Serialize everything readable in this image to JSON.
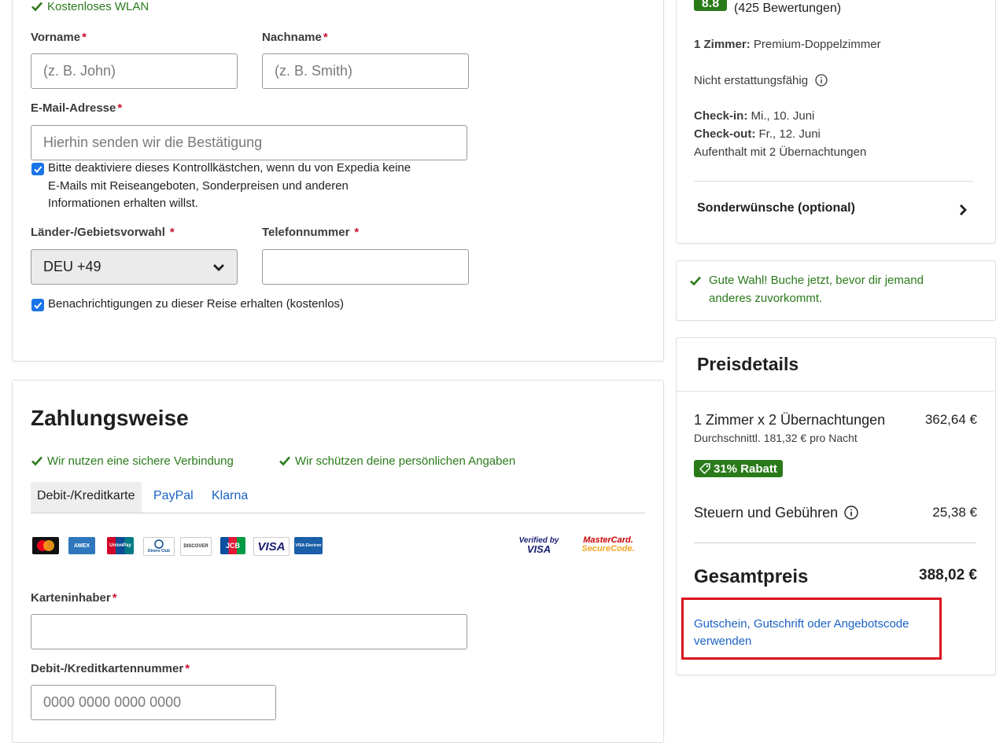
{
  "amenity": {
    "wifi": "Kostenloses WLAN"
  },
  "form": {
    "first_name_label": "Vorname",
    "first_name_placeholder": "(z. B. John)",
    "last_name_label": "Nachname",
    "last_name_placeholder": "(z. B. Smith)",
    "email_label": "E-Mail-Adresse",
    "email_placeholder": "Hierhin senden wir die Bestätigung",
    "marketing_line1": "Bitte deaktiviere dieses Kontrollkästchen, wenn du von Expedia keine",
    "marketing_line2": "E-Mails mit Reiseangeboten, Sonderpreisen und anderen",
    "marketing_line3": "Informationen erhalten willst.",
    "country_code_label": "Länder-/Gebietsvorwahl",
    "country_code_value": "DEU +49",
    "phone_label": "Telefonnummer",
    "notifications_label": "Benachrichtigungen zu dieser Reise erhalten (kostenlos)",
    "required_mark": "*"
  },
  "payment": {
    "title": "Zahlungsweise",
    "secure_connection": "Wir nutzen eine sichere Verbindung",
    "protect_data": "Wir schützen deine persönlichen Angaben",
    "tabs": [
      "Debit-/Kreditkarte",
      "PayPal",
      "Klarna"
    ],
    "card_logos": [
      "MasterCard",
      "AMEX",
      "UnionPay",
      "Diners Club",
      "DISCOVER",
      "JCB",
      "VISA",
      "VISA Electron"
    ],
    "verified_by": "Verified by",
    "verified_visa": "VISA",
    "mc_secure_1": "MasterCard.",
    "mc_secure_2": "SecureCode.",
    "holder_label": "Karteninhaber",
    "card_number_label": "Debit-/Kreditkartennummer",
    "card_number_placeholder": "0000 0000 0000 0000"
  },
  "booking": {
    "rating_score": "8.8",
    "reviews": "(425 Bewertungen)",
    "rooms_label": "1 Zimmer:",
    "rooms_value": "Premium-Doppelzimmer",
    "refund_policy": "Nicht erstattungsfähig",
    "checkin_label": "Check-in:",
    "checkin_value": "Mi., 10. Juni",
    "checkout_label": "Check-out:",
    "checkout_value": "Fr., 12. Juni",
    "stay": "Aufenthalt mit 2 Übernachtungen",
    "special_requests": "Sonderwünsche (optional)"
  },
  "notice": {
    "line1": "Gute Wahl! Buche jetzt, bevor dir jemand",
    "line2": "anderes zuvorkommt."
  },
  "price": {
    "title": "Preisdetails",
    "room_nights": "1 Zimmer x 2 Übernachtungen",
    "room_nights_value": "362,64 €",
    "avg_per_night": "Durchschnittl. 181,32 € pro Nacht",
    "discount": "31% Rabatt",
    "taxes_label": "Steuern und Gebühren",
    "taxes_value": "25,38 €",
    "total_label": "Gesamtpreis",
    "total_value": "388,02 €",
    "coupon_line1": "Gutschein, Gutschrift oder Angebotscode",
    "coupon_line2": "verwenden"
  },
  "colors": {
    "accent": "#1a73e8",
    "green": "#2a7a1a",
    "link": "#1b62c4",
    "highlight": "#d9141e"
  }
}
